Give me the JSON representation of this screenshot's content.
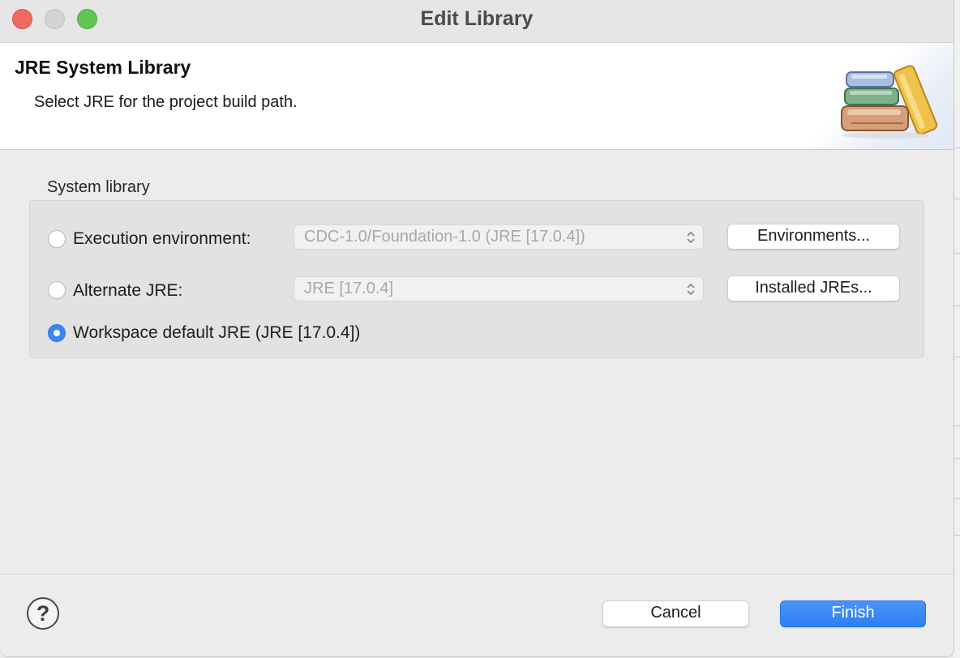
{
  "window": {
    "title": "Edit Library"
  },
  "banner": {
    "title": "JRE System Library",
    "description": "Select JRE for the project build path.",
    "icon": "library-books-icon"
  },
  "group": {
    "label": "System library",
    "options": [
      {
        "label": "Execution environment:",
        "selected": false,
        "select_value": "CDC-1.0/Foundation-1.0 (JRE [17.0.4])",
        "button": "Environments..."
      },
      {
        "label": "Alternate JRE:",
        "selected": false,
        "select_value": "JRE [17.0.4]",
        "button": "Installed JREs..."
      },
      {
        "label": "Workspace default JRE (JRE [17.0.4])",
        "selected": true
      }
    ]
  },
  "footer": {
    "help_symbol": "?",
    "cancel_label": "Cancel",
    "finish_label": "Finish"
  },
  "colors": {
    "accent": "#3b86f7",
    "close": "#ed6a5e",
    "minimize": "#d3d3d3",
    "maximize": "#61c454"
  }
}
